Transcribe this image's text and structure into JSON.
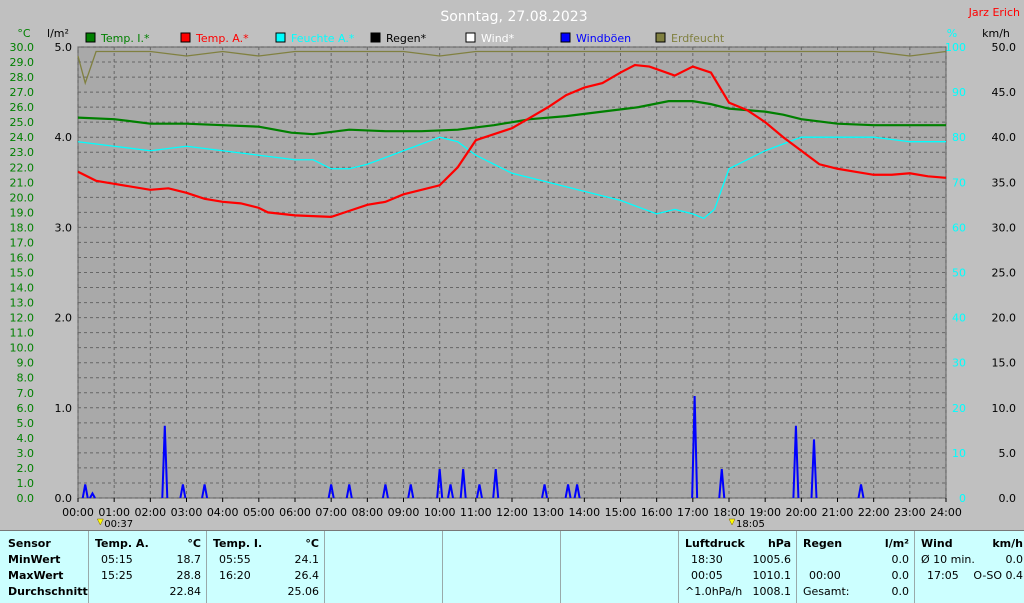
{
  "header": {
    "title": "Sonntag, 27.08.2023",
    "author": "Jarz Erich"
  },
  "legend": [
    {
      "label": "Temp. I.*",
      "color": "#008000"
    },
    {
      "label": "Temp. A.*",
      "color": "#ff0000"
    },
    {
      "label": "Feuchte A.*",
      "color": "#00ffff"
    },
    {
      "label": "Regen*",
      "color": "#000000"
    },
    {
      "label": "Wind*",
      "color": "#ffffff"
    },
    {
      "label": "Windböen",
      "color": "#0000ff"
    },
    {
      "label": "Erdfeucht",
      "color": "#808040"
    }
  ],
  "axes": {
    "left_unit": "°C",
    "rain_unit": "l/m²",
    "hum_unit": "%",
    "wind_unit": "km/h",
    "temp_ticks": [
      "0.0",
      "1.0",
      "2.0",
      "3.0",
      "4.0",
      "5.0",
      "6.0",
      "7.0",
      "8.0",
      "9.0",
      "10.0",
      "11.0",
      "12.0",
      "13.0",
      "14.0",
      "15.0",
      "16.0",
      "17.0",
      "18.0",
      "19.0",
      "20.0",
      "21.0",
      "22.0",
      "23.0",
      "24.0",
      "25.0",
      "26.0",
      "27.0",
      "28.0",
      "29.0",
      "30.0"
    ],
    "rain_ticks": [
      "0.0",
      "1.0",
      "2.0",
      "3.0",
      "4.0",
      "5.0"
    ],
    "hum_ticks": [
      "0",
      "10",
      "20",
      "30",
      "40",
      "50",
      "60",
      "70",
      "80",
      "90",
      "100"
    ],
    "wind_ticks": [
      "0.0",
      "5.0",
      "10.0",
      "15.0",
      "20.0",
      "25.0",
      "30.0",
      "35.0",
      "40.0",
      "45.0",
      "50.0"
    ],
    "x_ticks": [
      "00:00",
      "01:00",
      "02:00",
      "03:00",
      "04:00",
      "05:00",
      "06:00",
      "07:00",
      "08:00",
      "09:00",
      "10:00",
      "11:00",
      "12:00",
      "13:00",
      "14:00",
      "15:00",
      "16:00",
      "17:00",
      "18:00",
      "19:00",
      "20:00",
      "21:00",
      "22:00",
      "23:00",
      "24:00"
    ],
    "sunrise": "00:37",
    "sunset": "18:05"
  },
  "chart_data": {
    "type": "line",
    "title": "Sonntag, 27.08.2023",
    "x_unit": "hours",
    "temp_range": [
      0,
      30
    ],
    "rain_range": [
      0,
      5
    ],
    "hum_range": [
      0,
      100
    ],
    "wind_range": [
      0,
      50
    ],
    "grid": true,
    "series": [
      {
        "name": "Temp. I.*",
        "axis": "temp",
        "color": "#008000",
        "x": [
          0,
          1,
          2,
          3,
          4,
          5,
          5.9,
          6.5,
          7.5,
          8.5,
          9.5,
          10.5,
          11.5,
          12.5,
          13.5,
          14.5,
          15.5,
          16.33,
          17,
          17.5,
          18,
          18.5,
          19,
          19.5,
          20,
          21,
          22,
          23,
          24
        ],
        "y": [
          25.3,
          25.2,
          24.9,
          24.9,
          24.8,
          24.7,
          24.3,
          24.2,
          24.5,
          24.4,
          24.4,
          24.5,
          24.8,
          25.2,
          25.4,
          25.7,
          26,
          26.4,
          26.4,
          26.2,
          25.9,
          25.8,
          25.7,
          25.5,
          25.2,
          24.9,
          24.8,
          24.8,
          24.8
        ]
      },
      {
        "name": "Temp. A.*",
        "axis": "temp",
        "color": "#ff0000",
        "x": [
          0,
          0.5,
          1,
          2,
          2.5,
          3,
          3.5,
          4,
          4.5,
          5,
          5.25,
          6,
          7,
          7.5,
          8,
          8.5,
          9,
          9.5,
          10,
          10.5,
          11,
          11.5,
          12,
          12.5,
          13,
          13.5,
          14,
          14.5,
          15,
          15.4,
          15.8,
          16.5,
          17,
          17.5,
          18,
          18.5,
          19,
          19.5,
          20,
          20.5,
          21,
          21.5,
          22,
          22.5,
          23,
          23.5,
          24
        ],
        "y": [
          21.7,
          21.1,
          20.9,
          20.5,
          20.6,
          20.3,
          19.9,
          19.7,
          19.6,
          19.3,
          19.0,
          18.8,
          18.7,
          19.1,
          19.5,
          19.7,
          20.2,
          20.5,
          20.8,
          22.0,
          23.8,
          24.2,
          24.6,
          25.3,
          26.0,
          26.8,
          27.3,
          27.6,
          28.3,
          28.8,
          28.7,
          28.1,
          28.7,
          28.3,
          26.3,
          25.8,
          25.0,
          24.0,
          23.1,
          22.2,
          21.9,
          21.7,
          21.5,
          21.5,
          21.6,
          21.4,
          21.3
        ]
      },
      {
        "name": "Feuchte A.*",
        "axis": "hum",
        "color": "#00ffff",
        "x": [
          0,
          1,
          2,
          3,
          4,
          5,
          6,
          6.5,
          7,
          7.5,
          8,
          9,
          10,
          10.5,
          11,
          12,
          13,
          14,
          15,
          16,
          16.5,
          17,
          17.3,
          17.6,
          18,
          19,
          20,
          21,
          22,
          23,
          24
        ],
        "y": [
          79,
          78,
          77,
          78,
          77,
          76,
          75,
          75,
          73,
          73,
          74,
          77,
          80,
          79,
          76,
          72,
          70,
          68,
          66,
          63,
          64,
          63,
          62,
          64,
          73,
          77,
          80,
          80,
          80,
          79,
          79
        ]
      },
      {
        "name": "Erdfeucht",
        "axis": "hum",
        "color": "#808040",
        "x": [
          0,
          0.2,
          0.5,
          1,
          2,
          3,
          4,
          5,
          6,
          7,
          8,
          9,
          10,
          11,
          12,
          13,
          14,
          15,
          16,
          17,
          18,
          19,
          20,
          21,
          22,
          23,
          24
        ],
        "y": [
          98,
          92,
          99,
          99,
          99,
          98,
          99,
          98,
          99,
          99,
          99,
          99,
          98,
          99,
          99,
          99,
          99,
          99,
          99,
          99,
          99,
          99,
          99,
          99,
          99,
          98,
          99
        ]
      },
      {
        "name": "Windböen",
        "axis": "wind",
        "color": "#0000ff",
        "x": [
          0.2,
          0.4,
          2.4,
          2.9,
          3.5,
          7,
          7.5,
          8.5,
          9.2,
          10,
          10.3,
          10.65,
          11.1,
          11.55,
          12.9,
          13.55,
          13.8,
          17.05,
          17.8,
          19.85,
          20.35,
          21.65
        ],
        "y": [
          1.5,
          0.5,
          8,
          1.5,
          1.5,
          1.5,
          1.5,
          1.5,
          1.5,
          3.2,
          1.5,
          3.2,
          1.5,
          3.2,
          1.5,
          1.5,
          1.5,
          11.3,
          3.2,
          8,
          6.5,
          1.5
        ]
      }
    ]
  },
  "table": {
    "sensor": {
      "header": "Sensor",
      "rows": [
        "MinWert",
        "MaxWert",
        "Durchschnitt"
      ]
    },
    "temp_a": {
      "header": "Temp. A.",
      "unit": "°C",
      "min_time": "05:15",
      "min_val": "18.7",
      "max_time": "15:25",
      "max_val": "28.8",
      "avg": "22.84"
    },
    "temp_i": {
      "header": "Temp. I.",
      "unit": "°C",
      "min_time": "05:55",
      "min_val": "24.1",
      "max_time": "16:20",
      "max_val": "26.4",
      "avg": "25.06"
    },
    "pressure": {
      "header": "Luftdruck",
      "unit": "hPa",
      "min_time": "18:30",
      "min_val": "1005.6",
      "max_time": "00:05",
      "max_val": "1010.1",
      "trend_label": "^1.0hPa/h",
      "trend_val": "1008.1"
    },
    "rain": {
      "header": "Regen",
      "unit": "l/m²",
      "row1": "0.0",
      "time2": "00:00",
      "row2": "0.0",
      "total_label": "Gesamt:",
      "total": "0.0"
    },
    "wind": {
      "header": "Wind",
      "unit": "km/h",
      "avg_label": "Ø 10 min.",
      "avg_val": "0.0",
      "gust_time": "17:05",
      "gust_val": "O-SO 0.4"
    }
  }
}
